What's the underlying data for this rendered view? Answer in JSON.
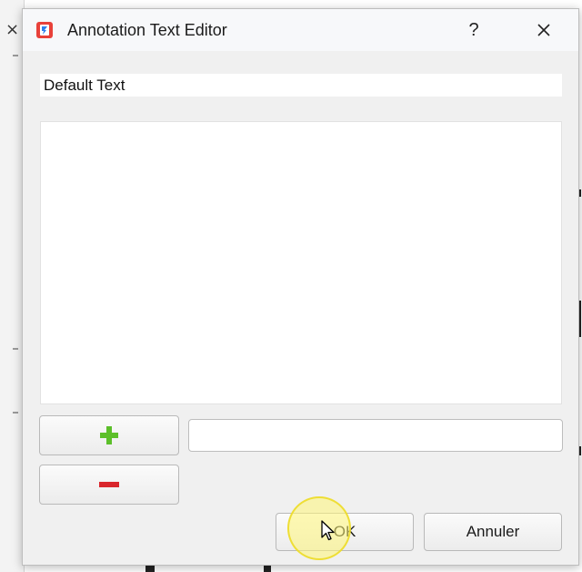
{
  "dialog": {
    "title": "Annotation Text Editor",
    "help_label": "?",
    "text_value": "Default Text",
    "entry_value": "",
    "add_label": "+",
    "remove_label": "−",
    "ok_label": "OK",
    "cancel_label": "Annuler"
  },
  "background": {
    "close_glyph": "×"
  },
  "colors": {
    "add": "#5cbf2a",
    "remove": "#d9262c",
    "app_icon": "#e8413a",
    "app_icon_inner": "#2f80ed",
    "highlight": "#fff36e"
  },
  "icons": {
    "app": "app-logo-icon",
    "help": "question-icon",
    "close": "close-icon",
    "cursor": "mouse-cursor-icon"
  }
}
